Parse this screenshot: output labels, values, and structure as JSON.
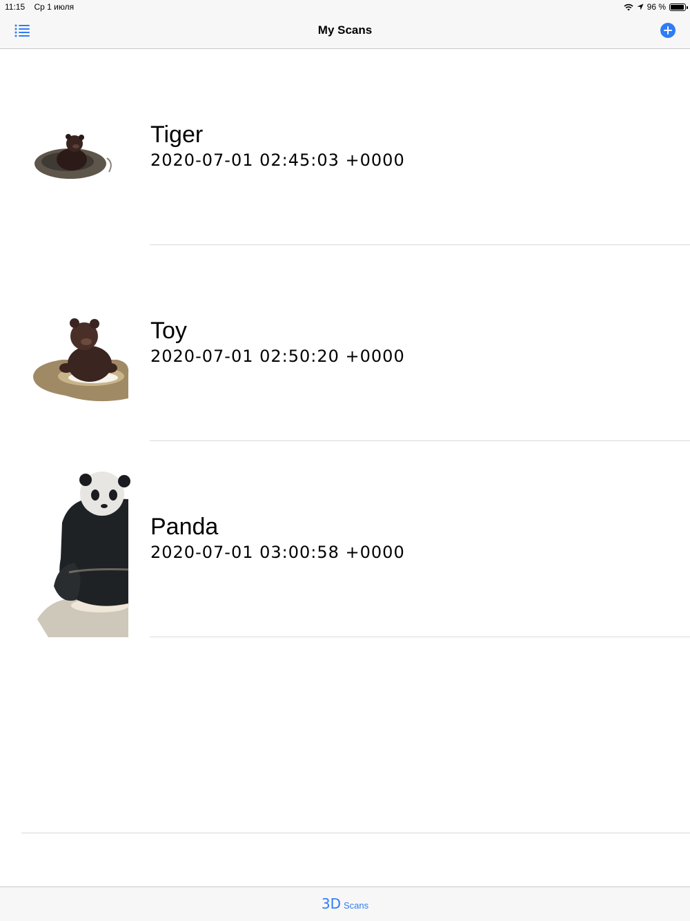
{
  "status_bar": {
    "time": "11:15",
    "date": "Ср 1 июля",
    "battery_text": "96 %",
    "battery_level": 0.96
  },
  "nav": {
    "title": "My Scans",
    "accent_color": "#2f7cf6"
  },
  "scans": [
    {
      "name": "Tiger",
      "date": "2020-07-01 02:45:03 +0000"
    },
    {
      "name": "Toy",
      "date": "2020-07-01 02:50:20 +0000"
    },
    {
      "name": "Panda",
      "date": "2020-07-01 03:00:58 +0000"
    }
  ],
  "tab_bar": {
    "icon_text": "3D",
    "label": "Scans"
  },
  "icons": {
    "menu": "list-icon",
    "add": "plus-circle-icon",
    "wifi": "wifi-icon",
    "location": "location-arrow-icon",
    "battery": "battery-icon"
  }
}
